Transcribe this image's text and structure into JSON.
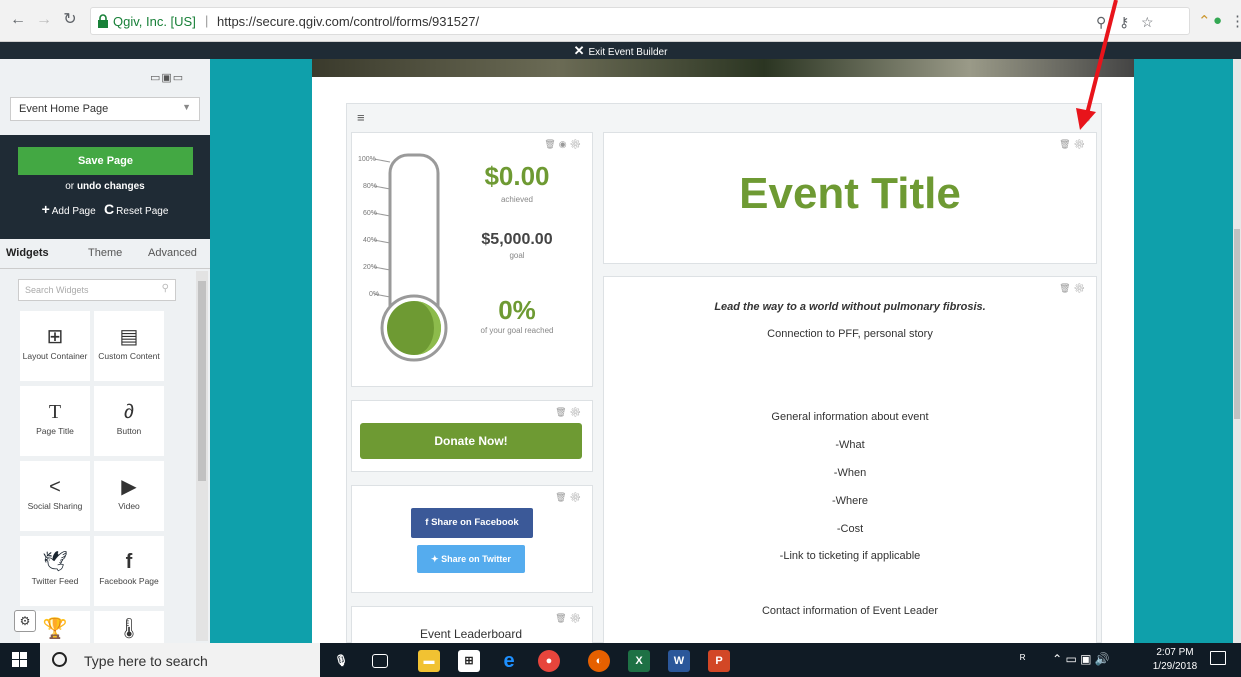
{
  "browser": {
    "site_name": "Qgiv, Inc. [US]",
    "url": "https://secure.qgiv.com/control/forms/931527/",
    "separator": "|"
  },
  "exit_bar": {
    "label": "Exit Event Builder"
  },
  "sidebar": {
    "page_select_value": "Event Home Page",
    "save_label": "Save Page",
    "undo_or": "or",
    "undo_label": "undo changes",
    "add_page_label": "Add Page",
    "reset_page_label": "Reset Page",
    "tabs": [
      {
        "label": "Widgets",
        "active": true
      },
      {
        "label": "Theme",
        "active": false
      },
      {
        "label": "Advanced",
        "active": false
      }
    ],
    "search_placeholder": "Search Widgets",
    "widgets": [
      {
        "label": "Layout Container",
        "icon": "layout-icon"
      },
      {
        "label": "Custom Content",
        "icon": "document-icon"
      },
      {
        "label": "Page Title",
        "icon": "text-icon"
      },
      {
        "label": "Button",
        "icon": "link-icon"
      },
      {
        "label": "Social Sharing",
        "icon": "share-icon"
      },
      {
        "label": "Video",
        "icon": "video-icon"
      },
      {
        "label": "Twitter Feed",
        "icon": "twitter-icon"
      },
      {
        "label": "Facebook Page",
        "icon": "facebook-icon"
      },
      {
        "label": "",
        "icon": "trophy-icon"
      },
      {
        "label": "",
        "icon": "thermometer-icon"
      }
    ]
  },
  "thermometer": {
    "ticks": [
      "100%",
      "80%",
      "60%",
      "40%",
      "20%",
      "0%"
    ],
    "achieved_value": "$0.00",
    "achieved_label": "achieved",
    "goal_value": "$5,000.00",
    "goal_label": "goal",
    "percent_value": "0%",
    "percent_label": "of your goal reached",
    "fill_fraction": 0
  },
  "donate": {
    "label": "Donate Now!"
  },
  "share": {
    "facebook_label": "Share on Facebook",
    "twitter_label": "Share on Twitter"
  },
  "leaderboard": {
    "title": "Event Leaderboard"
  },
  "event": {
    "title": "Event Title"
  },
  "description": {
    "lead": "Lead the way to a world without pulmonary fibrosis.",
    "line1": "Connection to PFF, personal story",
    "line2": "General information about event",
    "line3": "-What",
    "line4": "-When",
    "line5": "-Where",
    "line6": "-Cost",
    "line7": "-Link to ticketing if applicable",
    "line8": "Contact information of Event Leader"
  },
  "colors": {
    "teal": "#0fa0ab",
    "green": "#6e9a33",
    "save_green": "#43a843",
    "dark_panel": "#1f2b35",
    "facebook": "#3b5998",
    "twitter": "#55acee",
    "annotation_red": "#e8141b"
  },
  "taskbar": {
    "search_placeholder": "Type here to search",
    "time": "2:07 PM",
    "date": "1/29/2018"
  }
}
